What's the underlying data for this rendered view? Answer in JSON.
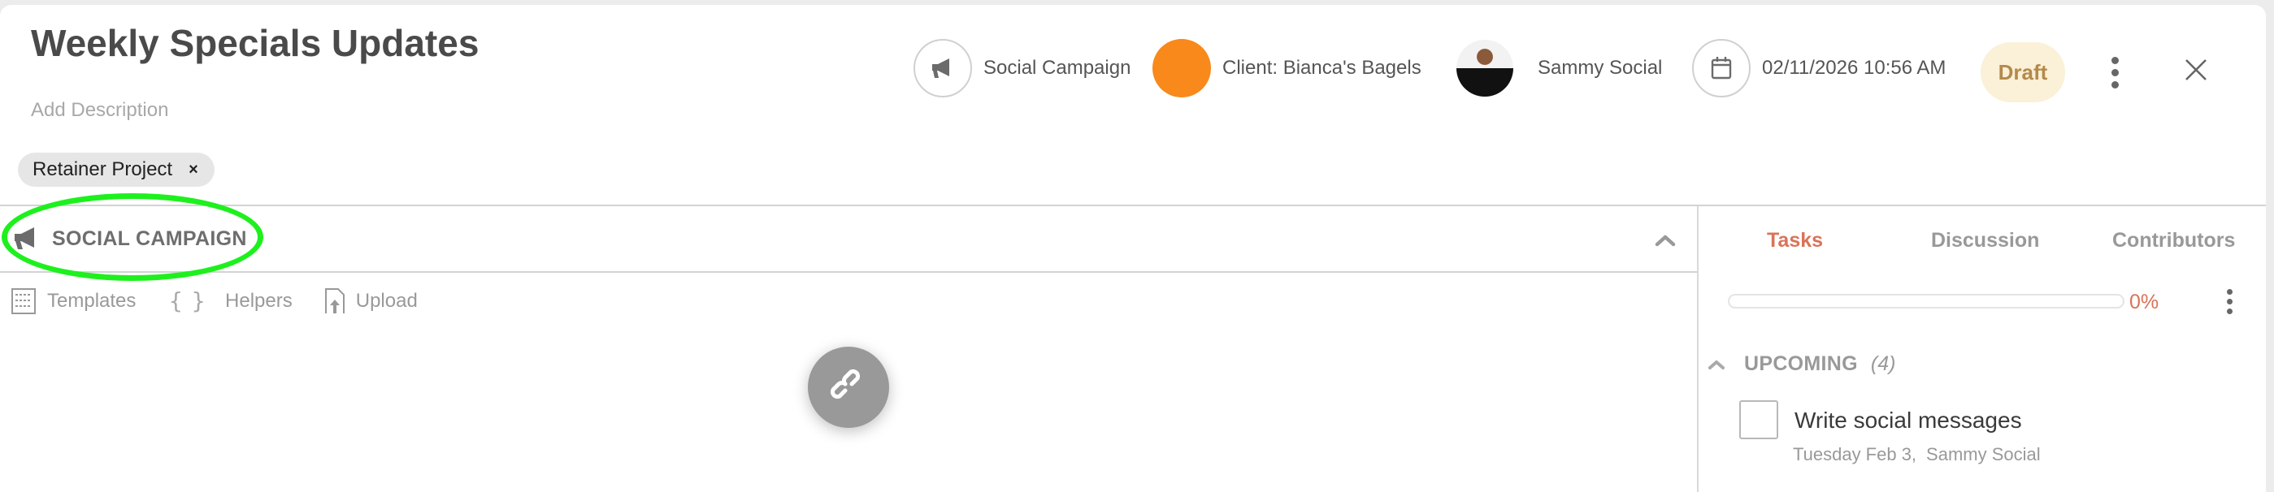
{
  "header": {
    "title": "Weekly Specials Updates",
    "description_placeholder": "Add Description",
    "tags": [
      {
        "label": "Retainer Project",
        "remove_icon": "×"
      }
    ],
    "type": {
      "icon": "megaphone-icon",
      "label": "Social Campaign"
    },
    "client": {
      "label": "Client: Bianca's Bagels",
      "color": "#f8891a"
    },
    "owner": {
      "name": "Sammy Social",
      "icon": "avatar"
    },
    "date": {
      "icon": "calendar-icon",
      "value": "02/11/2026 10:56 AM"
    },
    "status": {
      "label": "Draft",
      "color": "#b38a4a",
      "background": "#fbf0d8"
    }
  },
  "section": {
    "title": "SOCIAL CAMPAIGN",
    "annotation_color": "#1ef01e",
    "toolbar": [
      {
        "icon": "templates-icon",
        "label": "Templates"
      },
      {
        "icon": "braces-icon",
        "label": "Helpers"
      },
      {
        "icon": "upload-icon",
        "label": "Upload"
      }
    ],
    "fab": {
      "icon": "link-icon"
    }
  },
  "sidebar": {
    "tabs": [
      {
        "label": "Tasks",
        "active": true
      },
      {
        "label": "Discussion",
        "active": false
      },
      {
        "label": "Contributors",
        "active": false
      }
    ],
    "progress": {
      "percent": 0,
      "label": "0%"
    },
    "accent_color": "#d97359",
    "groups": [
      {
        "label": "UPCOMING",
        "count": "(4)",
        "tasks": [
          {
            "title": "Write social messages",
            "due": "Tuesday Feb 3,",
            "assignee": "Sammy Social",
            "done": false
          }
        ]
      }
    ]
  }
}
